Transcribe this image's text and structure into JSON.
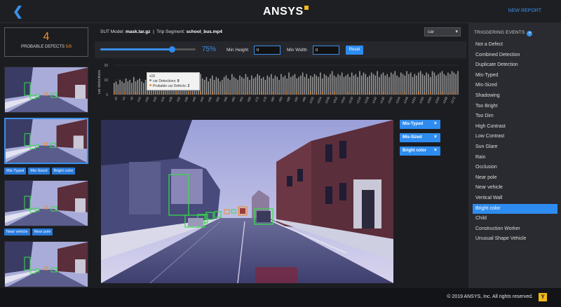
{
  "header": {
    "back_icon": "chevron-left-icon",
    "logo_text": "ANSYS",
    "new_report_label": "NEW REPORT"
  },
  "summary": {
    "defect_count": "4",
    "defect_label": "PROBABLE DEFECTS",
    "defect_total": "5/8"
  },
  "thumbnails": [
    {
      "tags": []
    },
    {
      "tags": [
        "Mis-Typed",
        "Mis-Sized",
        "Bright color"
      ]
    },
    {
      "tags": [
        "Near vehicle",
        "Near pole"
      ]
    },
    {
      "tags": []
    }
  ],
  "meta": {
    "sut_label": "SUT Model:",
    "sut_value": "mask.tar.gz",
    "separator": "|",
    "segment_label": "Trip Segment:",
    "segment_value": "school_bus.mp4"
  },
  "class_select": {
    "value": "car"
  },
  "controls": {
    "confidence_percent": "75%",
    "confidence_fraction": 0.75,
    "min_height_label": "Min Height",
    "min_height_value": "0",
    "min_width_label": "Min Width",
    "min_width_value": "0",
    "reset_label": "Reset"
  },
  "chart_data": {
    "type": "bar",
    "ylabel": "car detections",
    "ylim": [
      0,
      20
    ],
    "yticks": [
      0,
      10,
      20
    ],
    "x_tick_labels": [
      "s0",
      "s4",
      "s8",
      "s12",
      "s16",
      "s20",
      "s24",
      "s28",
      "s32",
      "s36",
      "s40",
      "s44",
      "s48",
      "s52",
      "s56",
      "s60",
      "s64",
      "s68",
      "s72",
      "s76",
      "s80",
      "s84",
      "s88",
      "s92",
      "s96",
      "s100",
      "s104",
      "s108",
      "s112",
      "s116",
      "s120",
      "s124",
      "s128",
      "s132",
      "s136",
      "s140",
      "s144",
      "s148",
      "s152",
      "s156",
      "s160",
      "s164",
      "s168",
      "s172"
    ],
    "series": [
      {
        "name": "car Detections",
        "color": "#9a9a9a"
      },
      {
        "name": "Probable car Defects",
        "color": "#f08b2b"
      }
    ],
    "bar_count": 176,
    "detections": [
      8,
      9,
      7,
      10,
      9,
      8,
      11,
      9,
      10,
      8,
      12,
      9,
      10,
      11,
      9,
      8,
      10,
      12,
      11,
      9,
      10,
      8,
      9,
      11,
      12,
      10,
      9,
      13,
      11,
      10,
      9,
      12,
      10,
      11,
      9,
      10,
      12,
      11,
      13,
      10,
      9,
      11,
      12,
      10,
      14,
      11,
      10,
      12,
      9,
      11,
      13,
      10,
      12,
      11,
      9,
      10,
      12,
      13,
      11,
      10,
      14,
      12,
      11,
      10,
      13,
      12,
      11,
      14,
      12,
      10,
      13,
      11,
      12,
      14,
      13,
      11,
      12,
      10,
      13,
      12,
      14,
      11,
      13,
      12,
      10,
      14,
      12,
      13,
      11,
      15,
      12,
      13,
      14,
      11,
      12,
      13,
      15,
      12,
      14,
      11,
      13,
      12,
      14,
      13,
      12,
      15,
      11,
      14,
      13,
      12,
      14,
      16,
      13,
      12,
      14,
      13,
      15,
      12,
      13,
      14,
      12,
      15,
      13,
      14,
      12,
      16,
      13,
      15,
      14,
      12,
      13,
      15,
      14,
      13,
      16,
      12,
      14,
      15,
      13,
      14,
      12,
      15,
      14,
      16,
      13,
      12,
      15,
      14,
      13,
      16,
      14,
      15,
      12,
      14,
      13,
      15,
      16,
      14,
      13,
      15,
      14,
      12,
      16,
      15,
      13,
      14,
      15,
      16,
      14,
      13,
      15,
      14,
      16,
      15,
      14,
      16
    ],
    "defects": [
      2,
      0,
      0,
      1,
      0,
      2,
      0,
      0,
      1,
      0,
      0,
      2,
      0,
      1,
      0,
      0,
      0,
      1,
      2,
      0,
      0,
      0,
      1,
      0,
      0,
      2,
      0,
      0,
      1,
      0,
      0,
      0,
      2,
      0,
      1,
      0,
      0,
      0,
      2,
      0,
      1,
      0,
      0,
      0,
      2,
      0,
      0,
      1,
      0,
      0,
      2,
      0,
      0,
      1,
      0,
      0,
      0,
      2,
      0,
      1,
      0,
      0,
      0,
      2,
      0,
      0,
      1,
      0,
      2,
      0,
      0,
      0,
      1,
      0,
      0,
      2,
      0,
      1,
      0,
      0,
      0,
      2,
      0,
      0,
      1,
      0,
      0,
      0,
      2,
      0,
      1,
      0,
      0,
      2,
      0,
      0,
      1,
      0,
      0,
      0,
      2,
      0,
      0,
      1,
      0,
      0,
      2,
      0,
      0,
      0,
      1,
      0,
      2,
      0,
      0,
      1,
      0,
      0,
      0,
      2,
      0,
      0,
      1,
      0,
      2,
      0,
      0,
      0,
      1,
      0,
      2,
      0,
      0,
      0,
      1,
      0,
      0,
      2,
      0,
      1,
      0,
      0,
      0,
      2,
      0,
      0,
      1,
      0,
      2,
      0,
      0,
      0,
      1,
      0,
      0,
      2,
      0,
      0,
      1,
      0,
      0,
      2,
      0,
      0,
      0,
      1,
      0,
      2,
      0,
      0,
      1,
      0,
      0,
      2,
      0,
      0
    ],
    "tooltip": {
      "title": "s16",
      "detections_label": "car Detections:",
      "detections_value": "9",
      "defects_label": "Probable car Defects:",
      "defects_value": "2"
    }
  },
  "defect_tags": [
    {
      "label": "Mis-Typed",
      "close": "×"
    },
    {
      "label": "Mis-Sized",
      "close": "×"
    },
    {
      "label": "Bright color",
      "close": "×"
    }
  ],
  "triggering_events": {
    "title": "TRIGGERING EVENTS",
    "add_icon": "plus-circle-icon",
    "items": [
      {
        "label": "Not a Defect",
        "active": false
      },
      {
        "label": "Combined Detection",
        "active": false
      },
      {
        "label": "Duplicate Detection",
        "active": false
      },
      {
        "label": "Mis-Typed",
        "active": false
      },
      {
        "label": "Mis-Sized",
        "active": false
      },
      {
        "label": "Shadowing",
        "active": false
      },
      {
        "label": "Too Bright",
        "active": false
      },
      {
        "label": "Too Dim",
        "active": false
      },
      {
        "label": "High Contrast",
        "active": false
      },
      {
        "label": "Low Contrast",
        "active": false
      },
      {
        "label": "Sun Glare",
        "active": false
      },
      {
        "label": "Rain",
        "active": false
      },
      {
        "label": "Occlusion",
        "active": false
      },
      {
        "label": "Near pole",
        "active": false
      },
      {
        "label": "Near vehicle",
        "active": false
      },
      {
        "label": "Vertical Wall",
        "active": false
      },
      {
        "label": "Bright color",
        "active": true
      },
      {
        "label": "Child",
        "active": false
      },
      {
        "label": "Construction Worker",
        "active": false
      },
      {
        "label": "Unusual Shape Vehicle",
        "active": false
      }
    ]
  },
  "footer": {
    "copyright": "© 2019 ANSYS, Inc. All rights reserved.",
    "logo_glyph": "Y"
  },
  "colors": {
    "accent": "#2e8cf0",
    "defect_orange": "#f08b2b",
    "detection_green": "#35e046",
    "background": "#1c1d21"
  }
}
